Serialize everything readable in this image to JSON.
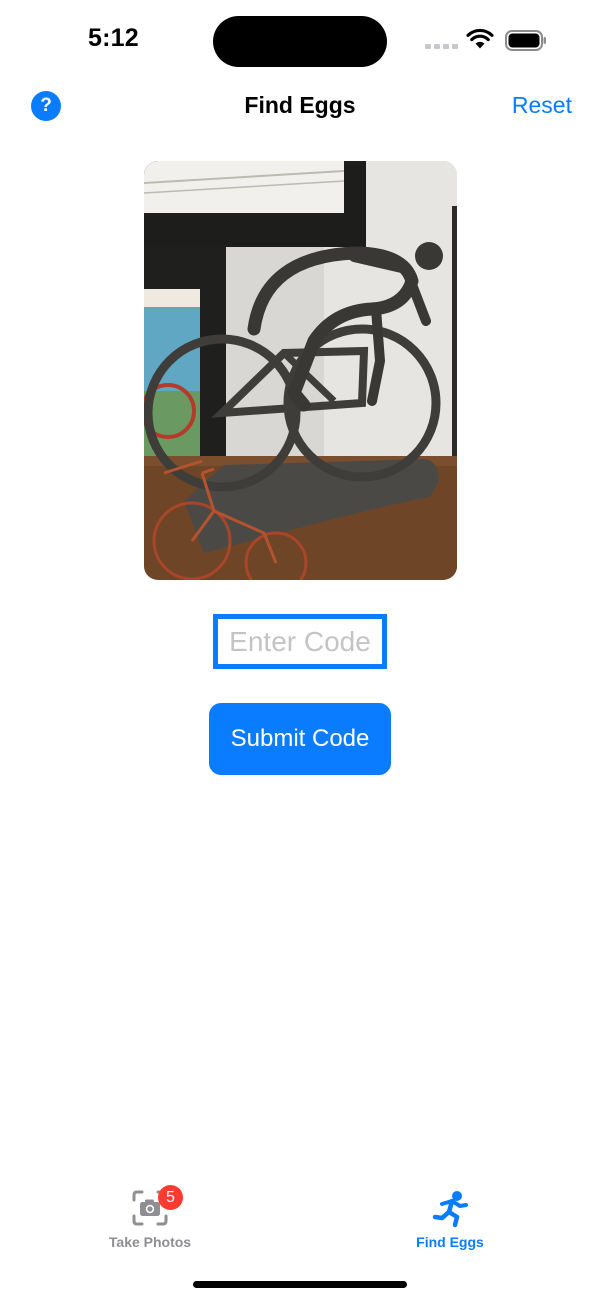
{
  "status_bar": {
    "time": "5:12"
  },
  "nav": {
    "help_label": "?",
    "title": "Find Eggs",
    "reset_label": "Reset"
  },
  "photo": {
    "subject": "cyclist-sculpture-photo"
  },
  "code_input": {
    "value": "",
    "placeholder": "Enter Code"
  },
  "submit": {
    "label": "Submit Code"
  },
  "tab_bar": {
    "tabs": [
      {
        "label": "Take Photos",
        "icon": "camera-viewfinder-icon",
        "badge": "5",
        "selected": false
      },
      {
        "label": "Find Eggs",
        "icon": "running-figure-icon",
        "badge": "",
        "selected": true
      }
    ]
  },
  "colors": {
    "accent": "#0a7cff",
    "badge": "#ff3b30",
    "inactive_tab": "#8e8e93",
    "placeholder": "#c4c4c7"
  }
}
